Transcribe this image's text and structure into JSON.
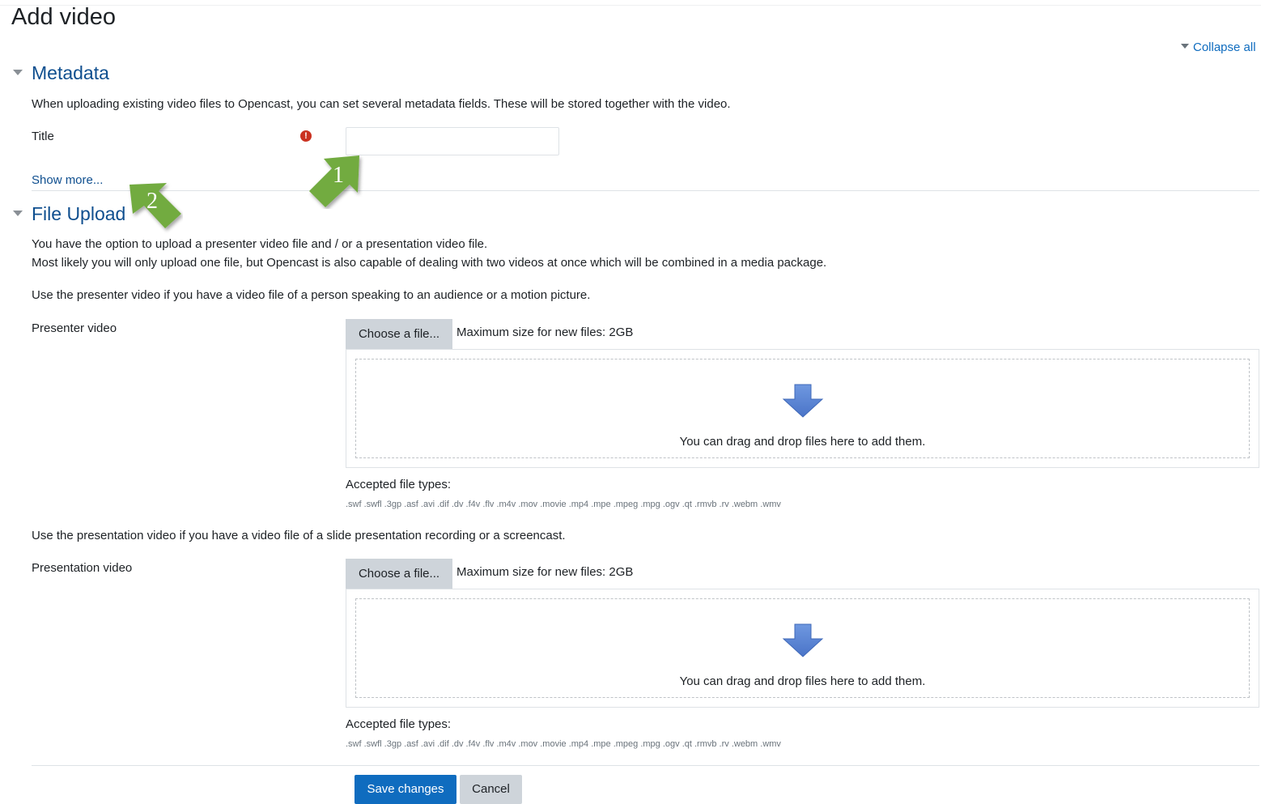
{
  "page": {
    "title": "Add video"
  },
  "collapse_all_label": "Collapse all",
  "metadata": {
    "heading": "Metadata",
    "description": "When uploading existing video files to Opencast, you can set several metadata fields. These will be stored together with the video.",
    "title_label": "Title",
    "title_value": "",
    "show_more": "Show more..."
  },
  "file_upload": {
    "heading": "File Upload",
    "intro_line1": "You have the option to upload a presenter video file and / or a presentation video file.",
    "intro_line2": "Most likely you will only upload one file, but Opencast is also capable of dealing with two videos at once which will be combined in a media package.",
    "presenter_hint": "Use the presenter video if you have a video file of a person speaking to an audience or a motion picture.",
    "presenter": {
      "label": "Presenter video",
      "choose_label": "Choose a file...",
      "max_size": "Maximum size for new files: 2GB",
      "drop_text": "You can drag and drop files here to add them.",
      "accepted_label": "Accepted file types:",
      "accepted_types": ".swf .swfl .3gp .asf .avi .dif .dv .f4v .flv .m4v .mov .movie .mp4 .mpe .mpeg .mpg .ogv .qt .rmvb .rv .webm .wmv"
    },
    "presentation_hint": "Use the presentation video if you have a video file of a slide presentation recording or a screencast.",
    "presentation": {
      "label": "Presentation video",
      "choose_label": "Choose a file...",
      "max_size": "Maximum size for new files: 2GB",
      "drop_text": "You can drag and drop files here to add them.",
      "accepted_label": "Accepted file types:",
      "accepted_types": ".swf .swfl .3gp .asf .avi .dif .dv .f4v .flv .m4v .mov .movie .mp4 .mpe .mpeg .mpg .ogv .qt .rmvb .rv .webm .wmv"
    }
  },
  "buttons": {
    "save": "Save changes",
    "cancel": "Cancel"
  },
  "callouts": [
    {
      "number": "1"
    },
    {
      "number": "2"
    }
  ],
  "colors": {
    "link": "#0f4f8f",
    "primary": "#0f6cbf",
    "required": "#ca3120",
    "callout": "#72ab3f",
    "drop_arrow": "#5b86d6"
  }
}
